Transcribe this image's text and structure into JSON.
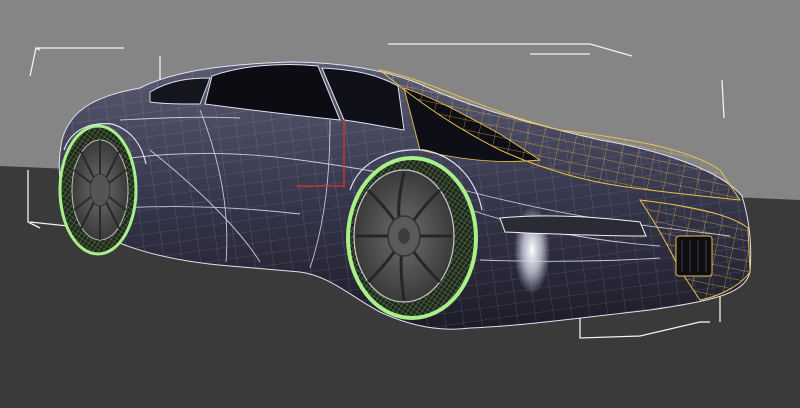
{
  "viewport": {
    "background_color": "#858585",
    "ground_color": "#3a3a3a",
    "selected_color": "#e8c14a",
    "wheel_highlight_color": "#a9f08a",
    "bounding_box_color": "#f2f2f2",
    "gizmo_color": "#e0302c"
  },
  "scene": {
    "object": "sports-car",
    "display_mode": "wireframe-on-shaded"
  }
}
